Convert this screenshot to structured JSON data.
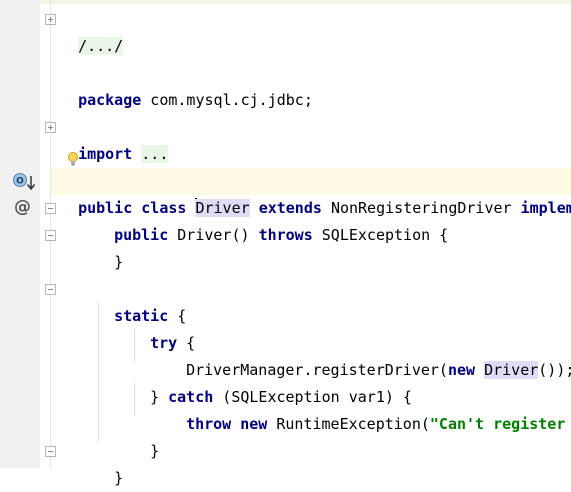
{
  "editor": {
    "lines": [
      {
        "id": "header-comment",
        "text": "/.../"
      },
      {
        "id": "package-kw",
        "text": "package"
      },
      {
        "id": "package-name",
        "text": " com.mysql.cj.jdbc;"
      },
      {
        "id": "import-kw",
        "text": "import"
      },
      {
        "id": "import-fold",
        "text": "..."
      }
    ],
    "class_decl": {
      "public": "public",
      "class": "class",
      "name_first": "D",
      "name_rest": "river",
      "extends": "extends",
      "parent": "NonRegisteringDriver",
      "tail": "implem"
    },
    "ctor": {
      "public": "public",
      "name": "Driver()",
      "throws": "throws",
      "exception": "SQLException {",
      "close": "}"
    },
    "static_block": {
      "static": "static",
      "open": " {",
      "try": "try",
      "try_open": " {",
      "call_prefix": "DriverManager.registerDriver(",
      "new": "new",
      "driver": "Driver",
      "call_suffix": "());",
      "catch_close": "} ",
      "catch": "catch",
      "catch_args": " (SQLException var1) {",
      "throw": "throw",
      "new2": "new",
      "runtime": " RuntimeException(",
      "string": "\"Can't register",
      "inner_close": "}",
      "outer_close": "}"
    }
  },
  "gutter": {
    "override_icon": "overrides-method-icon",
    "at_icon": "at-sign-icon",
    "at_glyph": "@",
    "bulb_icon": "intention-bulb-icon",
    "override_letter": "O"
  }
}
